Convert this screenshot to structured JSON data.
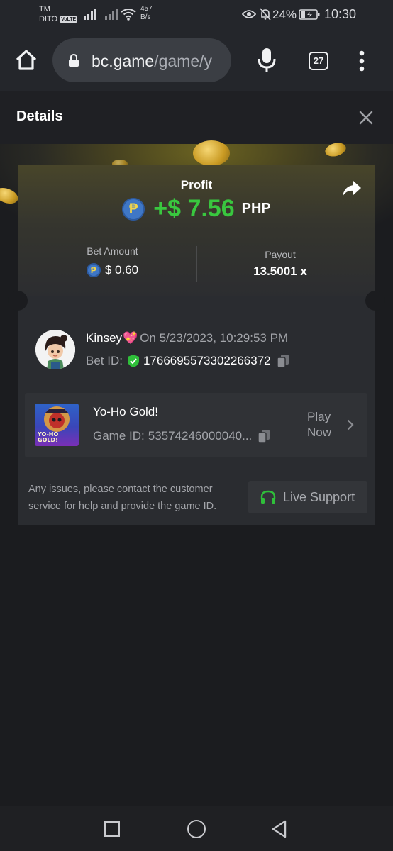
{
  "status_bar": {
    "carrier_top": "TM",
    "carrier_bottom": "DITO",
    "volte": "VoLTE",
    "speed_value": "457",
    "speed_unit": "B/s",
    "battery": "24%",
    "time": "10:30"
  },
  "browser": {
    "url_host": "bc.game",
    "url_path": "/game/y",
    "tab_count": "27"
  },
  "details": {
    "title": "Details"
  },
  "result": {
    "profit_label": "Profit",
    "currency_symbol": "₱",
    "profit_value": "+$ 7.56",
    "profit_currency": "PHP",
    "bet_amount_label": "Bet Amount",
    "bet_amount_value": "$ 0.60",
    "payout_label": "Payout",
    "payout_value": "13.5001 x"
  },
  "bet": {
    "user_name": "Kinsey",
    "heart": "💖",
    "date_text": "On 5/23/2023, 10:29:53 PM",
    "bet_id_label": "Bet ID:",
    "bet_id_value": "1766695573302266372"
  },
  "game": {
    "title": "Yo-Ho Gold!",
    "thumb_text_1": "YO-HO",
    "thumb_text_2": "GOLD!",
    "game_id_label": "Game ID:",
    "game_id_value": "53574246000040...",
    "play_now_line1": "Play",
    "play_now_line2": "Now"
  },
  "support": {
    "text": "Any issues, please contact the customer service for help and provide the game ID.",
    "button_label": "Live Support"
  },
  "colors": {
    "accent_green": "#39c73f",
    "background": "#1b1c1f",
    "card": "#2a2c30"
  }
}
